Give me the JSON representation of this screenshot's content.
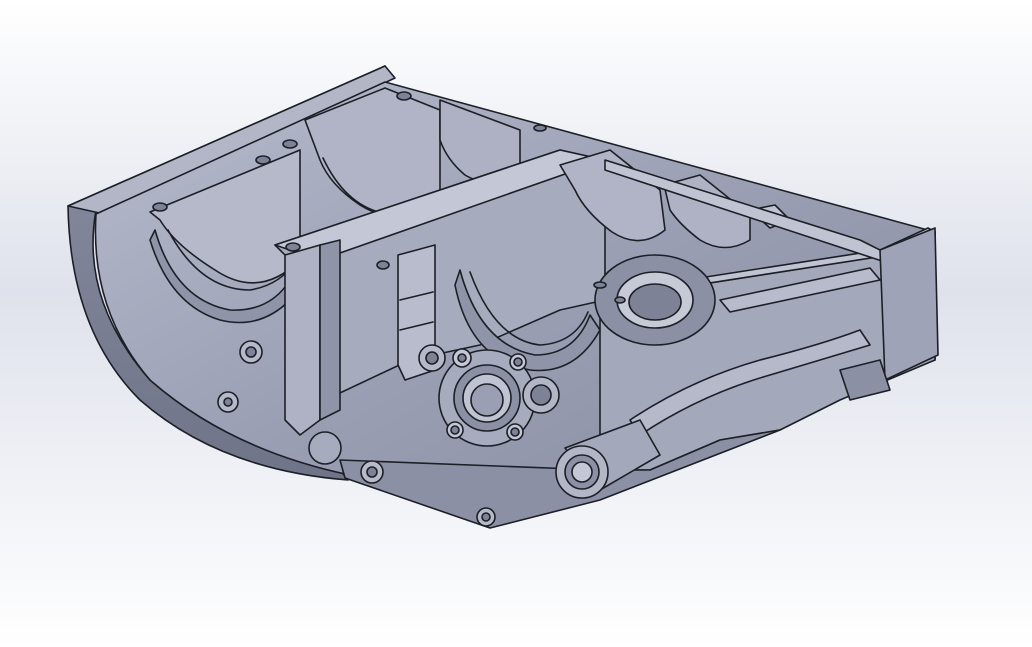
{
  "viewport": {
    "background_top": "#ffffff",
    "background_bottom": "#ffffff",
    "background_mid": "#dfe2ec"
  },
  "model": {
    "body_color": "#9a9fb4",
    "light_color": "#b7bbcc",
    "dark_color": "#6f7488",
    "edge_color": "#1d1f27"
  }
}
